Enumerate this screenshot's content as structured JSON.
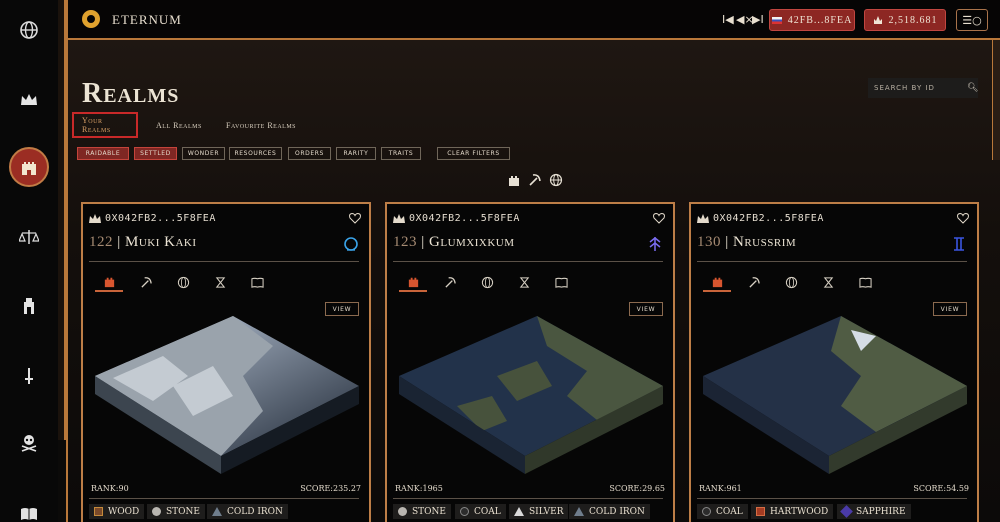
{
  "header": {
    "title": "ETERNUM",
    "wallet": "42FB...8FEA",
    "balance": "2,518.681"
  },
  "colors": {
    "accent": "#b9783a",
    "danger": "#8d2723",
    "active_tab": "#c82929"
  },
  "page": {
    "title": "Realms",
    "search_placeholder": "SEARCH BY ID"
  },
  "tabs": [
    {
      "label": "Your Realms"
    },
    {
      "label": "All Realms"
    },
    {
      "label": "Favourite Realms"
    }
  ],
  "filters": [
    "RAIDABLE",
    "SETTLED",
    "WONDER",
    "RESOURCES",
    "ORDERS",
    "RARITY",
    "TRAITS",
    "CLEAR FILTERS"
  ],
  "cards": [
    {
      "owner": "0X042FB2...5F8FEA",
      "id": "122",
      "name": "Muki Kaki",
      "view_label": "VIEW",
      "rank": "RANK:90",
      "score": "SCORE:235.27",
      "resources": [
        {
          "name": "WOOD",
          "color": "#7a4a2a"
        },
        {
          "name": "STONE",
          "color": "#b9b6b1"
        },
        {
          "name": "COLD IRON",
          "color": "#6f7d8c"
        }
      ]
    },
    {
      "owner": "0X042FB2...5F8FEA",
      "id": "123",
      "name": "Glumxixkum",
      "view_label": "VIEW",
      "rank": "RANK:1965",
      "score": "SCORE:29.65",
      "resources": [
        {
          "name": "STONE",
          "color": "#b9b6b1"
        },
        {
          "name": "COAL",
          "color": "#2c2c2c"
        },
        {
          "name": "SILVER",
          "color": "#d9d9d9"
        },
        {
          "name": "COLD IRON",
          "color": "#6f7d8c"
        }
      ]
    },
    {
      "owner": "0X042FB2...5F8FEA",
      "id": "130",
      "name": "Nrussrim",
      "view_label": "VIEW",
      "rank": "RANK:961",
      "score": "SCORE:54.59",
      "resources": [
        {
          "name": "COAL",
          "color": "#2c2c2c"
        },
        {
          "name": "HARTWOOD",
          "color": "#a43b22"
        },
        {
          "name": "SAPPHIRE",
          "color": "#4a3aa8"
        }
      ]
    }
  ]
}
